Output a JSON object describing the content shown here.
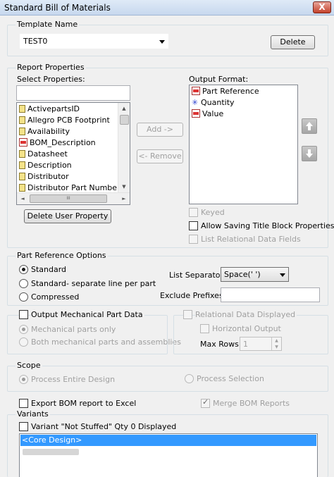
{
  "window": {
    "title": "Standard Bill of Materials",
    "close_glyph": "X"
  },
  "template": {
    "legend": "Template Name",
    "value": "TEST0",
    "delete_label": "Delete"
  },
  "report": {
    "legend": "Report Properties",
    "select_label": "Select Properties:",
    "output_label": "Output Format:",
    "search_value": "",
    "select_items": [
      {
        "label": "ActivepartsID",
        "icon": "doc-icon"
      },
      {
        "label": "Allegro PCB Footprint",
        "icon": "doc-icon"
      },
      {
        "label": "Availability",
        "icon": "doc-icon"
      },
      {
        "label": "BOM_Description",
        "icon": "property-icon"
      },
      {
        "label": "Datasheet",
        "icon": "doc-icon"
      },
      {
        "label": "Description",
        "icon": "doc-icon"
      },
      {
        "label": "Distributor",
        "icon": "doc-icon"
      },
      {
        "label": "Distributor Part Number",
        "icon": "doc-icon"
      }
    ],
    "output_items": [
      {
        "label": "Part Reference",
        "icon": "property-icon"
      },
      {
        "label": "Quantity",
        "icon": "star-icon",
        "glyph": "✳"
      },
      {
        "label": "Value",
        "icon": "property-icon"
      }
    ],
    "add_label": "Add ->",
    "remove_label": "<- Remove",
    "delete_user_property_label": "Delete User Property",
    "scroll_left_glyph": "◄",
    "scroll_right_glyph": "►",
    "scroll_up_glyph": "▲",
    "scroll_down_glyph": "▼",
    "scroll_thumb_glyph": "III",
    "keyed_label": "Keyed",
    "allow_title_block_label": "Allow Saving Title Block Properties",
    "list_relational_label": "List Relational Data Fields"
  },
  "part_reference": {
    "legend": "Part Reference Options",
    "standard_label": "Standard",
    "standard_separate_label": "Standard- separate line per part",
    "compressed_label": "Compressed",
    "list_separator_label": "List Separator:",
    "list_separator_value": "Space(' ')",
    "exclude_prefixes_label": "Exclude Prefixes:",
    "exclude_prefixes_value": ""
  },
  "mechanical": {
    "output_label": "Output Mechanical Part Data",
    "mech_only_label": "Mechanical parts only",
    "both_label": "Both mechanical parts and assemblies"
  },
  "relational": {
    "label": "Relational Data Displayed",
    "horizontal_label": "Horizontal Output",
    "max_rows_label": "Max Rows",
    "max_rows_value": "1",
    "spin_up_glyph": "▲",
    "spin_down_glyph": "▼"
  },
  "scope": {
    "legend": "Scope",
    "entire_label": "Process Entire Design",
    "selection_label": "Process Selection"
  },
  "export": {
    "excel_label": "Export BOM report to Excel",
    "merge_label": "Merge BOM Reports",
    "merge_checkmark": "✓"
  },
  "variants": {
    "legend": "Variants",
    "not_stuffed_label": "Variant \"Not Stuffed\" Qty 0 Displayed",
    "items": [
      "<Core Design>"
    ]
  },
  "colors": {
    "selection": "#3399ff",
    "disabled_text": "#a0a0a0",
    "group_border": "#d5dfe5"
  }
}
